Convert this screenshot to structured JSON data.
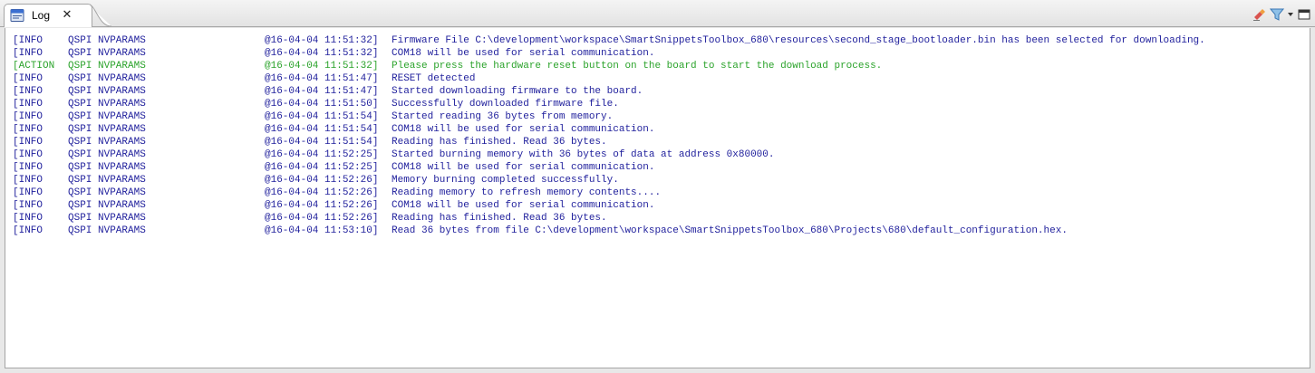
{
  "tab": {
    "title": "Log",
    "icon": "log-file-icon"
  },
  "toolbar": {
    "icons": [
      "clear-log-icon",
      "filter-icon",
      "view-menu-chevron-icon",
      "maximize-icon"
    ]
  },
  "log": {
    "rows": [
      {
        "level": "[INFO",
        "module": "QSPI NVPARAMS",
        "time": "@16-04-04 11:51:32]",
        "message": "Firmware File C:\\development\\workspace\\SmartSnippetsToolbox_680\\resources\\second_stage_bootloader.bin has been selected for downloading."
      },
      {
        "level": "[INFO",
        "module": "QSPI NVPARAMS",
        "time": "@16-04-04 11:51:32]",
        "message": "COM18 will be used for serial communication."
      },
      {
        "level": "[ACTION",
        "module": "QSPI NVPARAMS",
        "time": "@16-04-04 11:51:32]",
        "message": "Please press the hardware reset button on the board to start the download process."
      },
      {
        "level": "[INFO",
        "module": "QSPI NVPARAMS",
        "time": "@16-04-04 11:51:47]",
        "message": "RESET detected"
      },
      {
        "level": "[INFO",
        "module": "QSPI NVPARAMS",
        "time": "@16-04-04 11:51:47]",
        "message": "Started downloading firmware to the board."
      },
      {
        "level": "[INFO",
        "module": "QSPI NVPARAMS",
        "time": "@16-04-04 11:51:50]",
        "message": "Successfully downloaded firmware file."
      },
      {
        "level": "[INFO",
        "module": "QSPI NVPARAMS",
        "time": "@16-04-04 11:51:54]",
        "message": "Started reading 36 bytes from memory."
      },
      {
        "level": "[INFO",
        "module": "QSPI NVPARAMS",
        "time": "@16-04-04 11:51:54]",
        "message": "COM18 will be used for serial communication."
      },
      {
        "level": "[INFO",
        "module": "QSPI NVPARAMS",
        "time": "@16-04-04 11:51:54]",
        "message": "Reading has finished. Read 36 bytes."
      },
      {
        "level": "[INFO",
        "module": "QSPI NVPARAMS",
        "time": "@16-04-04 11:52:25]",
        "message": "Started burning memory with 36 bytes of data at address 0x80000."
      },
      {
        "level": "[INFO",
        "module": "QSPI NVPARAMS",
        "time": "@16-04-04 11:52:25]",
        "message": "COM18 will be used for serial communication."
      },
      {
        "level": "[INFO",
        "module": "QSPI NVPARAMS",
        "time": "@16-04-04 11:52:26]",
        "message": "Memory burning completed successfully."
      },
      {
        "level": "[INFO",
        "module": "QSPI NVPARAMS",
        "time": "@16-04-04 11:52:26]",
        "message": "Reading memory to refresh memory contents...."
      },
      {
        "level": "[INFO",
        "module": "QSPI NVPARAMS",
        "time": "@16-04-04 11:52:26]",
        "message": "COM18 will be used for serial communication."
      },
      {
        "level": "[INFO",
        "module": "QSPI NVPARAMS",
        "time": "@16-04-04 11:52:26]",
        "message": "Reading has finished. Read 36 bytes."
      },
      {
        "level": "[INFO",
        "module": "QSPI NVPARAMS",
        "time": "@16-04-04 11:53:10]",
        "message": "Read 36 bytes from file C:\\development\\workspace\\SmartSnippetsToolbox_680\\Projects\\680\\default_configuration.hex."
      }
    ]
  },
  "colors": {
    "info": "#1f1f9c",
    "action": "#2ba32b"
  }
}
